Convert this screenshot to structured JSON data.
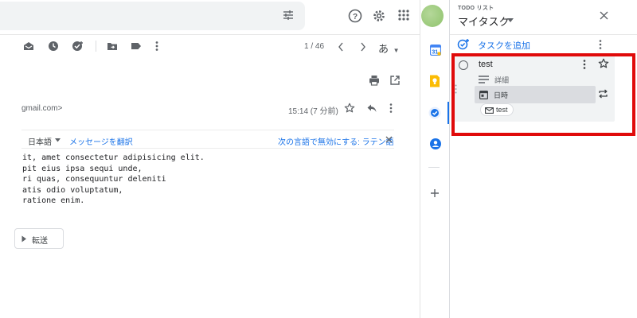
{
  "toolbar": {
    "page_count": "1 / 46",
    "input_tools_label": "あ"
  },
  "message": {
    "sender_email": "gmail.com>",
    "time": "15:14 (7 分前)",
    "translate": {
      "language": "日本語",
      "translate_link": "メッセージを翻訳",
      "disable_link": "次の言語で無効にする: ラテン語"
    },
    "body_lines": [
      "it, amet consectetur adipisicing elit.",
      "pit eius ipsa sequi unde,",
      "ri quas, consequuntur deleniti",
      "atis odio voluptatum,",
      "ratione enim."
    ],
    "forward_label": "転送"
  },
  "tasks_panel": {
    "kicker": "TODO リスト",
    "title": "マイタスク",
    "add_task_label": "タスクを追加",
    "task": {
      "title": "test",
      "details_label": "詳細",
      "date_label": "日時",
      "email_chip_label": "test"
    }
  },
  "colors": {
    "accent": "#1a73e8",
    "highlight": "#e00a0a",
    "card_bg": "#f1f3f4"
  }
}
